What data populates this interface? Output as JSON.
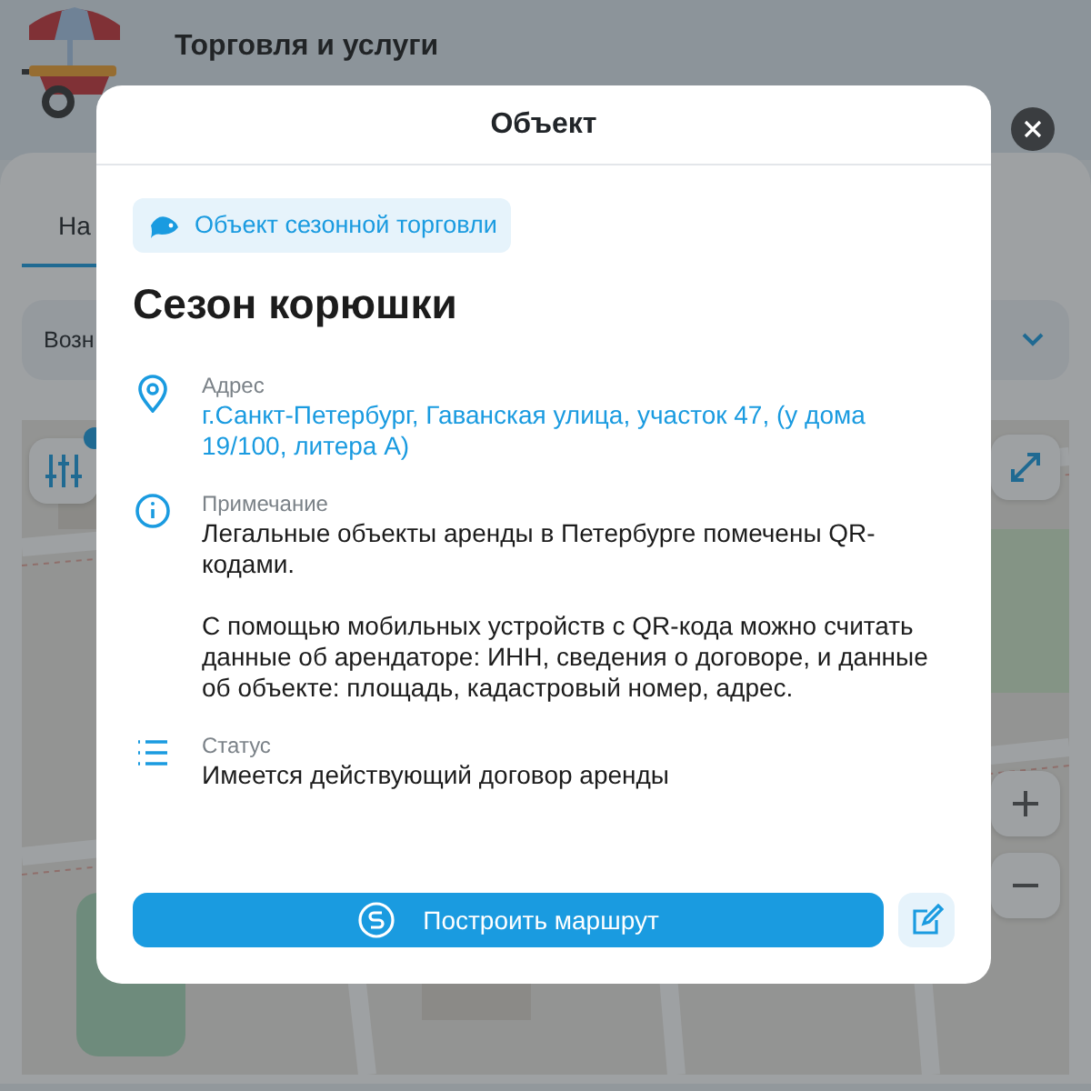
{
  "app": {
    "title": "Торговля и услуги",
    "tabs": [
      {
        "label": "На",
        "selected": true
      }
    ],
    "filter": {
      "value": "Возн"
    },
    "filter_badge": true
  },
  "modal": {
    "title": "Объект",
    "category": "Объект сезонной торговли",
    "name": "Сезон корюшки",
    "fields": [
      {
        "kind": "address",
        "label": "Адрес",
        "paragraphs": [
          "г.Санкт-Петербург, Гаванская улица, участок 47, (у дома 19/100, литера А)"
        ]
      },
      {
        "kind": "note",
        "label": "Примечание",
        "paragraphs": [
          "Легальные объекты аренды в Петербурге помечены QR-кодами.",
          "С помощью мобильных устройств с QR-кода можно считать данные об арендаторе: ИНН, сведения о договоре, и данные об объекте: площадь, кадастровый номер, адрес."
        ]
      },
      {
        "kind": "status",
        "label": "Статус",
        "paragraphs": [
          "Имеется действующий договор аренды"
        ]
      }
    ],
    "route_button": "Построить маршрут"
  }
}
